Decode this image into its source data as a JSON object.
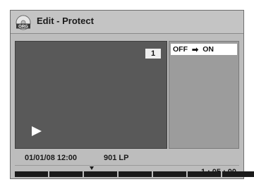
{
  "header": {
    "title": "Edit - Protect",
    "disc_label": "ORG"
  },
  "video": {
    "title_number": "1"
  },
  "side_menu": {
    "option": {
      "from": "OFF",
      "arrow": "➡",
      "to": "ON"
    }
  },
  "info": {
    "datetime": "01/01/08 12:00",
    "recording": "901  LP"
  },
  "timeline": {
    "segments": 7,
    "time": "1 : 05 : 00"
  },
  "colors": {
    "background": "#bdbdbd",
    "video": "#595959",
    "side": "#9c9c9c",
    "highlight": "#ffffff"
  }
}
